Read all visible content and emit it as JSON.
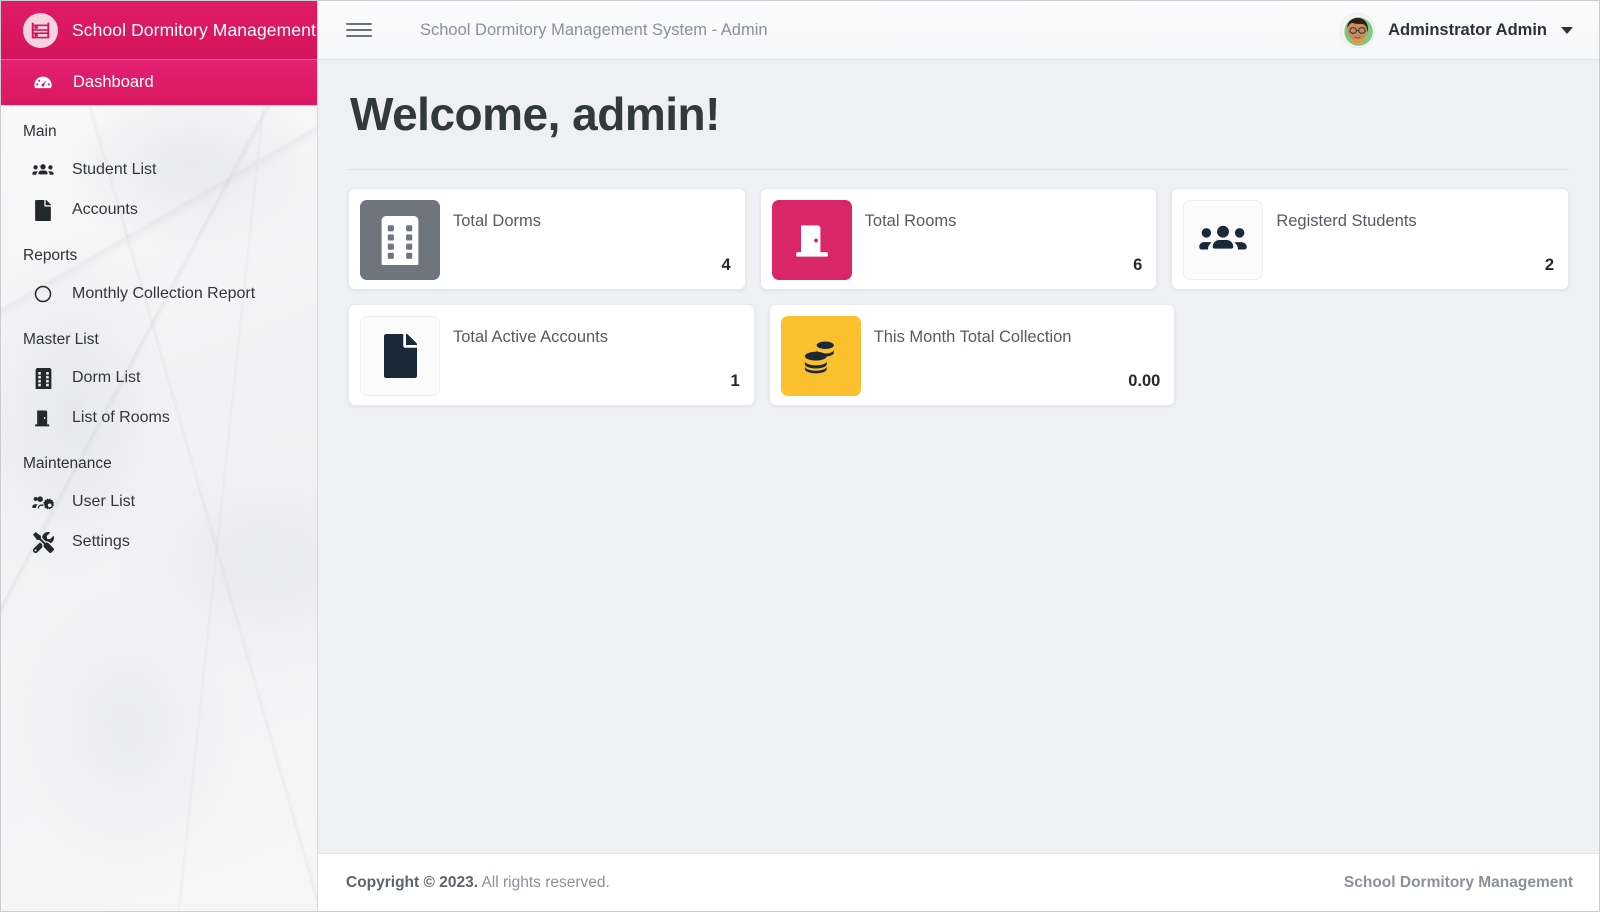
{
  "brand": {
    "title": "School Dormitory Management",
    "logo_icon": "bunk-bed-icon"
  },
  "sidebar": {
    "active_item": {
      "label": "Dashboard",
      "icon": "tachometer-icon"
    },
    "groups": [
      {
        "title": "Main",
        "items": [
          {
            "label": "Student List",
            "icon": "users-icon"
          },
          {
            "label": "Accounts",
            "icon": "file-icon"
          }
        ]
      },
      {
        "title": "Reports",
        "items": [
          {
            "label": "Monthly Collection Report",
            "icon": "circle-icon"
          }
        ]
      },
      {
        "title": "Master List",
        "items": [
          {
            "label": "Dorm List",
            "icon": "building-icon"
          },
          {
            "label": "List of Rooms",
            "icon": "door-icon"
          }
        ]
      },
      {
        "title": "Maintenance",
        "items": [
          {
            "label": "User List",
            "icon": "users-cog-icon"
          },
          {
            "label": "Settings",
            "icon": "tools-icon"
          }
        ]
      }
    ]
  },
  "topbar": {
    "menu_icon": "hamburger-icon",
    "title": "School Dormitory Management System - Admin",
    "user": {
      "name": "Adminstrator Admin",
      "avatar_icon": "user-avatar",
      "caret_icon": "chevron-down-icon"
    }
  },
  "main": {
    "page_title": "Welcome, admin!",
    "cards": [
      {
        "label": "Total Dorms",
        "value": "4",
        "icon": "building-icon",
        "tile_bg": "#6f757c",
        "icon_color": "#ffffff"
      },
      {
        "label": "Total Rooms",
        "value": "6",
        "icon": "door-icon",
        "tile_bg": "#d92668",
        "icon_color": "#ffffff"
      },
      {
        "label": "Registerd Students",
        "value": "2",
        "icon": "users-icon",
        "tile_bg": "#fbfbfc",
        "icon_color": "#1b2838"
      },
      {
        "label": "Total Active Accounts",
        "value": "1",
        "icon": "file-icon",
        "tile_bg": "#fbfbfc",
        "icon_color": "#1b2838"
      },
      {
        "label": "This Month Total Collection",
        "value": "0.00",
        "icon": "coins-icon",
        "tile_bg": "#fbc02d",
        "icon_color": "#1b2838"
      }
    ]
  },
  "footer": {
    "copyright_strong": "Copyright © 2023.",
    "copyright_rest": " All rights reserved.",
    "brand": "School Dormitory Management"
  },
  "colors": {
    "brand_pink": "#d4145a",
    "active_pink": "#e32072",
    "page_bg": "#eef0f4",
    "card_bg": "#ffffff",
    "accent_yellow": "#fbc02d",
    "accent_gray": "#6f757c",
    "text_dark": "#23282e"
  }
}
